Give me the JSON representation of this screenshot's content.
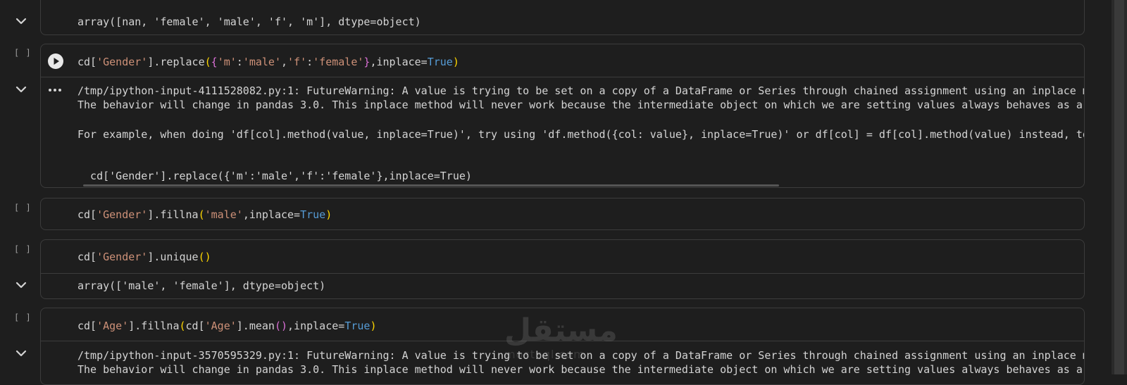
{
  "execution_count_empty": "[ ]",
  "cell0": {
    "output": "array([nan, 'female', 'male', 'f', 'm'], dtype=object)"
  },
  "cell1": {
    "code": {
      "p1": "cd[",
      "p2": "'Gender'",
      "p3": "].replace",
      "p4": "(",
      "p5": "{",
      "p6": "'m'",
      "p7": ":",
      "p8": "'male'",
      "p9": ",",
      "p10": "'f'",
      "p11": ":",
      "p12": "'female'",
      "p13": "}",
      "p14": ",inplace=",
      "p15": "True",
      "p16": ")"
    },
    "output_lines": [
      "/tmp/ipython-input-4111528082.py:1: FutureWarning: A value is trying to be set on a copy of a DataFrame or Series through chained assignment using an inplace m",
      "The behavior will change in pandas 3.0. This inplace method will never work because the intermediate object on which we are setting values always behaves as a",
      "For example, when doing 'df[col].method(value, inplace=True)', try using 'df.method({col: value}, inplace=True)' or df[col] = df[col].method(value) instead, to",
      "  cd['Gender'].replace({'m':'male','f':'female'},inplace=True)"
    ]
  },
  "cell2": {
    "code": {
      "p1": "cd[",
      "p2": "'Gender'",
      "p3": "].fillna",
      "p4": "(",
      "p5": "'male'",
      "p6": ",inplace=",
      "p7": "True",
      "p8": ")"
    }
  },
  "cell3": {
    "code": {
      "p1": "cd[",
      "p2": "'Gender'",
      "p3": "].unique",
      "p4": "()"
    },
    "output": "array(['male', 'female'], dtype=object)"
  },
  "cell4": {
    "code": {
      "p1": "cd[",
      "p2": "'Age'",
      "p3": "].fillna",
      "p4": "(",
      "p5": "cd[",
      "p6": "'Age'",
      "p7": "].mean",
      "p8": "()",
      "p9": ",inplace=",
      "p10": "True",
      "p11": ")"
    },
    "output_lines": [
      "/tmp/ipython-input-3570595329.py:1: FutureWarning: A value is trying to be set on a copy of a DataFrame or Series through chained assignment using an inplace m",
      "The behavior will change in pandas 3.0. This inplace method will never work because the intermediate object on which we are setting values always behaves as a"
    ]
  },
  "watermark": {
    "main": "مستقل",
    "sub": "mostaql.com"
  },
  "colors": {
    "background": "#1e1e1e",
    "string": "#ce9178",
    "boolean": "#569cd6",
    "brace": "#da70d6",
    "paren": "#ffd700"
  },
  "icons": {
    "run": "play-circle-icon",
    "collapse": "chevron-down-icon",
    "more": "ellipsis-icon"
  }
}
